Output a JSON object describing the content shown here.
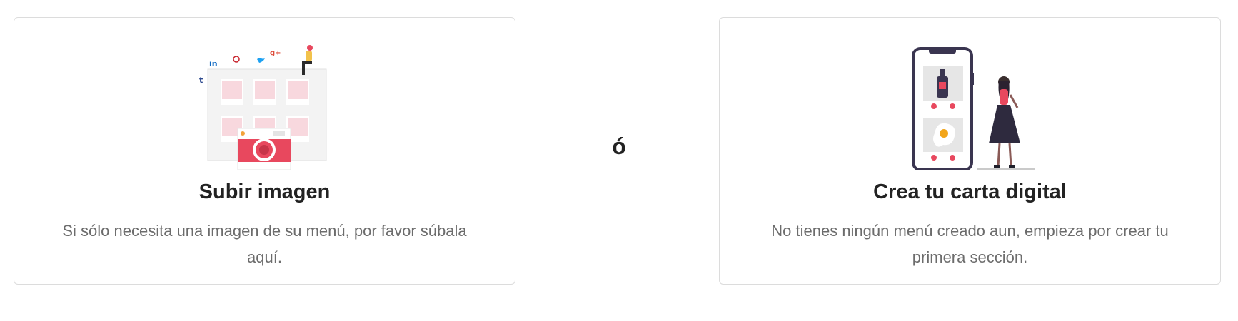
{
  "upload_card": {
    "title": "Subir imagen",
    "description": "Si sólo necesita una imagen de su menú, por favor súbala aquí."
  },
  "separator": {
    "label": "ó"
  },
  "digital_card": {
    "title": "Crea tu carta digital",
    "description": "No tienes ningún menú creado aun, empieza por crear tu primera sección."
  },
  "colors": {
    "accent": "#e8485e",
    "pink_light": "#f8d8de",
    "dark": "#3a3550",
    "title": "#222222",
    "text": "#6c6c6c",
    "border": "#dcdcdc"
  },
  "icons": [
    "upload-image-illustration",
    "linkedin-icon",
    "pinterest-icon",
    "twitter-icon",
    "google-plus-icon",
    "tumblr-icon",
    "camera-icon",
    "phone-menu-illustration"
  ]
}
